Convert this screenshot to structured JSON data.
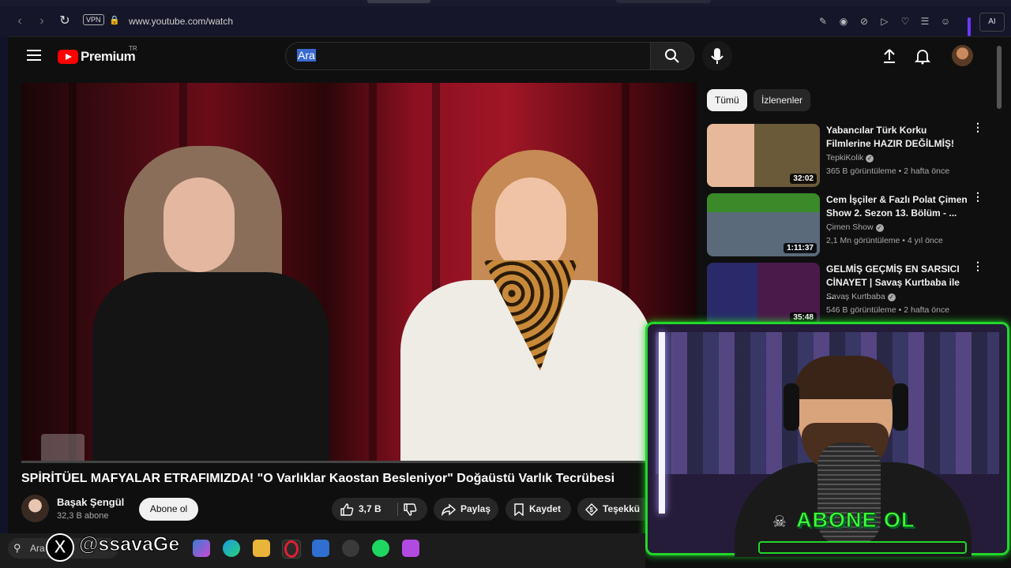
{
  "browser": {
    "vpn_label": "VPN",
    "url": "www.youtube.com/watch",
    "ai_label": "AI"
  },
  "header": {
    "logo_text": "Premium",
    "region": "TR",
    "search_placeholder": "Ara"
  },
  "video": {
    "title": "SPİRİTÜEL MAFYALAR ETRAFIMIZDA! \"O Varlıklar Kaostan Besleniyor\" Doğaüstü Varlık Tecrübesi",
    "channel": "Başak Şengül",
    "subscribers": "32,3 B abone",
    "subscribe_label": "Abone ol",
    "likes": "3,7 B",
    "share_label": "Paylaş",
    "save_label": "Kaydet",
    "thanks_label": "Teşekkü"
  },
  "chips": [
    "Tümü",
    "İzlenenler"
  ],
  "recommendations": [
    {
      "title": "Yabancılar Türk Korku Filmlerine HAZIR DEĞİLMİŞ!",
      "channel": "TepkiKolik",
      "meta": "365 B görüntüleme • 2 hafta önce",
      "duration": "32:02"
    },
    {
      "title": "Cem İşçiler & Fazlı Polat Çimen Show 2. Sezon 13. Bölüm - ...",
      "channel": "Çimen Show",
      "meta": "2,1 Mn görüntüleme • 4 yıl önce",
      "duration": "1:11:37"
    },
    {
      "title": "GELMİŞ GEÇMİŞ EN SARSICI CİNAYET | Savaş Kurtbaba ile ...",
      "channel": "Savaş Kurtbaba",
      "meta": "546 B görüntüleme • 2 hafta önce",
      "duration": "35:48"
    }
  ],
  "overlay": {
    "abone_text": "ABONE OL",
    "x_handle": "@ssavaGe"
  },
  "taskbar": {
    "search_text": "Ara"
  }
}
